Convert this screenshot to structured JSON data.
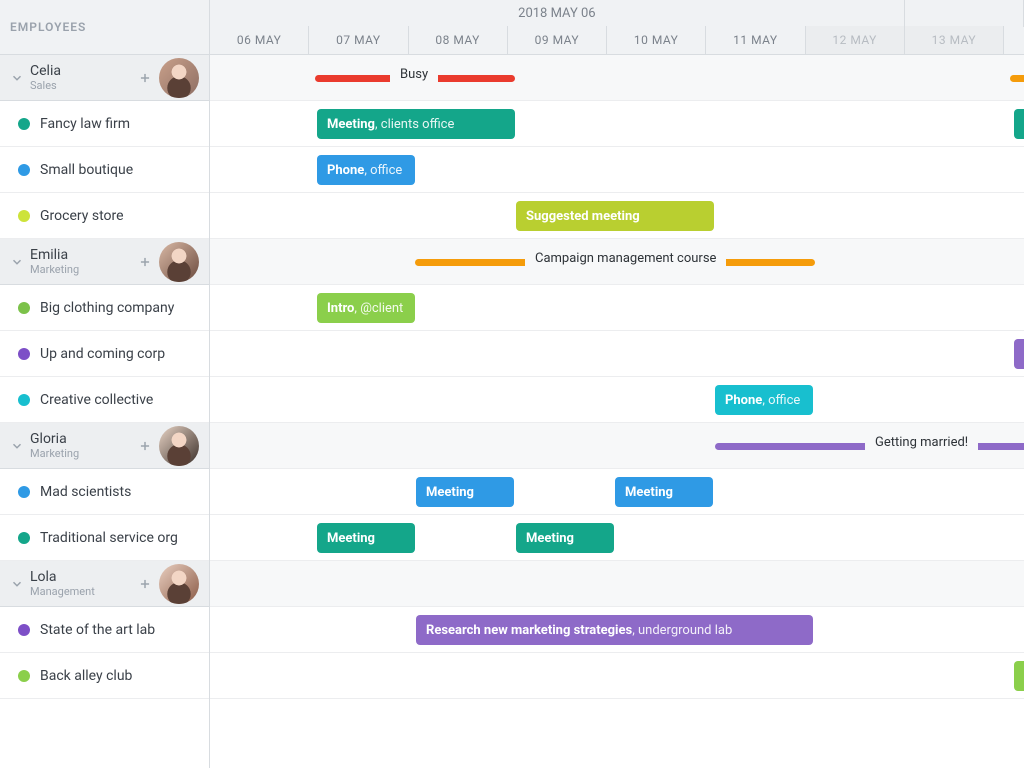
{
  "header": {
    "employees_label": "EMPLOYEES",
    "date_title": "2018 MAY 06"
  },
  "days": [
    {
      "label": "06 MAY",
      "key": "06"
    },
    {
      "label": "07 MAY",
      "key": "07"
    },
    {
      "label": "08 MAY",
      "key": "08"
    },
    {
      "label": "09 MAY",
      "key": "09"
    },
    {
      "label": "10 MAY",
      "key": "10"
    },
    {
      "label": "11 MAY",
      "key": "11"
    },
    {
      "label": "12 MAY",
      "key": "12",
      "weekend": true
    },
    {
      "label": "13 MAY",
      "key": "13",
      "weekend": true
    }
  ],
  "colors": {
    "teal": "#14a68a",
    "blue": "#2f9ae5",
    "lime": "#b9cf30",
    "limeDot": "#cde33a",
    "orange": "#f59c0b",
    "red": "#ea3b2e",
    "purple": "#8e6ac8",
    "cyan": "#18bfcf",
    "green": "#7cc24a",
    "violetDot": "#7d4fc7",
    "lightgreen": "#8bcf4b"
  },
  "employees": [
    {
      "name": "Celia",
      "dept": "Sales",
      "busy_label": "Busy",
      "clients": [
        {
          "label": "Fancy law firm",
          "dot": "teal"
        },
        {
          "label": "Small boutique",
          "dot": "blue"
        },
        {
          "label": "Grocery store",
          "dot": "limeDot"
        }
      ]
    },
    {
      "name": "Emilia",
      "dept": "Marketing",
      "busy_label": "Campaign management course",
      "clients": [
        {
          "label": "Big clothing company",
          "dot": "green"
        },
        {
          "label": "Up and coming corp",
          "dot": "violetDot"
        },
        {
          "label": "Creative collective",
          "dot": "cyan"
        }
      ]
    },
    {
      "name": "Gloria",
      "dept": "Marketing",
      "busy_label": "Getting married!",
      "clients": [
        {
          "label": "Mad scientists",
          "dot": "blue"
        },
        {
          "label": "Traditional service org",
          "dot": "teal"
        }
      ]
    },
    {
      "name": "Lola",
      "dept": "Management",
      "clients": [
        {
          "label": "State of the art lab",
          "dot": "violetDot"
        },
        {
          "label": "Back alley club",
          "dot": "lightgreen"
        }
      ]
    }
  ],
  "events": {
    "celia_fancy": {
      "title": "Meeting",
      "detail": ", clients office",
      "color": "teal",
      "start": 1,
      "span": 2
    },
    "celia_boutique": {
      "title": "Phone",
      "detail": ", office",
      "color": "blue",
      "start": 1,
      "span": 1
    },
    "celia_grocery": {
      "title": "Suggested meeting",
      "detail": "",
      "color": "lime",
      "start": 3,
      "span": 2
    },
    "emilia_big": {
      "title": "Intro",
      "detail": ", @client",
      "color": "green",
      "start": 1,
      "span": 1
    },
    "emilia_creative": {
      "title": "Phone",
      "detail": ", office",
      "color": "cyan",
      "start": 5,
      "span": 1
    },
    "gloria_mad1": {
      "title": "Meeting",
      "detail": "",
      "color": "blue",
      "start": 2,
      "span": 1
    },
    "gloria_mad2": {
      "title": "Meeting",
      "detail": "",
      "color": "blue",
      "start": 4,
      "span": 1
    },
    "gloria_trad1": {
      "title": "Meeting",
      "detail": "",
      "color": "teal",
      "start": 1,
      "span": 1
    },
    "gloria_trad2": {
      "title": "Meeting",
      "detail": "",
      "color": "teal",
      "start": 3,
      "span": 1
    },
    "lola_lab": {
      "title": "Research new marketing strategies",
      "detail": ", underground lab",
      "color": "purple",
      "start": 2,
      "span": 4
    }
  }
}
